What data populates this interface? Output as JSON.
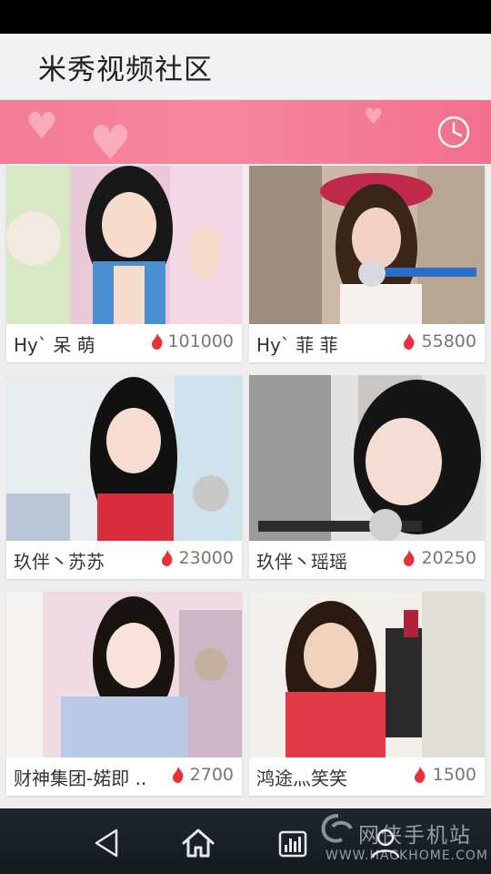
{
  "header": {
    "title": "米秀视频社区"
  },
  "banner": {
    "history_icon": "clock-icon"
  },
  "streams": [
    {
      "name": "Hy` 呆 萌",
      "views": "101000"
    },
    {
      "name": "Hy` 菲 菲",
      "views": "55800"
    },
    {
      "name": "玖伴丶苏苏",
      "views": "23000"
    },
    {
      "name": "玖伴丶瑶瑶",
      "views": "20250"
    },
    {
      "name": "财神集团-婼即 ..",
      "views": "2700"
    },
    {
      "name": "鸿途灬笑笑",
      "views": "1500"
    }
  ],
  "nav": {
    "back_icon": "back-triangle-icon",
    "home_icon": "home-icon",
    "recents_icon": "chart-icon",
    "profile_icon": "user-icon"
  },
  "watermark": {
    "main": "网侠手机站",
    "sub": "WWW.HACKHOME.COM"
  },
  "colors": {
    "banner": "#f47c95",
    "flame": "#e8313a",
    "nav": "#1a2029"
  }
}
